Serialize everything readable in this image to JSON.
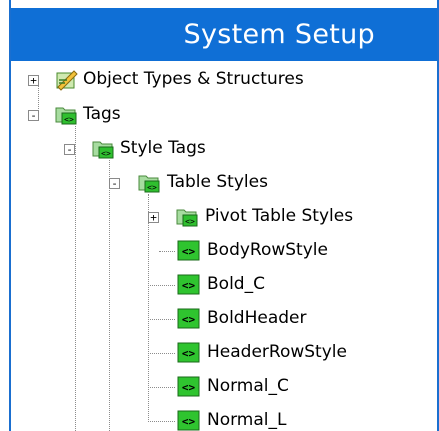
{
  "panel": {
    "title": "System Setup"
  },
  "colors": {
    "titlebar": "#0f6fd6",
    "title_text": "#ffffff",
    "tag_icon_green": "#27c427",
    "folder_green": "#8fd48a"
  },
  "tree": {
    "items": [
      {
        "label": "Object Types & Structures",
        "icon": "object-types-icon",
        "toggle": "+"
      },
      {
        "label": "Tags",
        "icon": "tag-folder-icon",
        "toggle": "-"
      },
      {
        "label": "Style Tags",
        "icon": "tag-folder-icon",
        "toggle": "-"
      },
      {
        "label": "Table Styles",
        "icon": "tag-folder-icon",
        "toggle": "-"
      },
      {
        "label": "Pivot Table Styles",
        "icon": "tag-folder-icon",
        "toggle": "+"
      },
      {
        "label": "BodyRowStyle",
        "icon": "tag-icon"
      },
      {
        "label": "Bold_C",
        "icon": "tag-icon"
      },
      {
        "label": "BoldHeader",
        "icon": "tag-icon"
      },
      {
        "label": "HeaderRowStyle",
        "icon": "tag-icon"
      },
      {
        "label": "Normal_C",
        "icon": "tag-icon"
      },
      {
        "label": "Normal_L",
        "icon": "tag-icon"
      }
    ]
  }
}
